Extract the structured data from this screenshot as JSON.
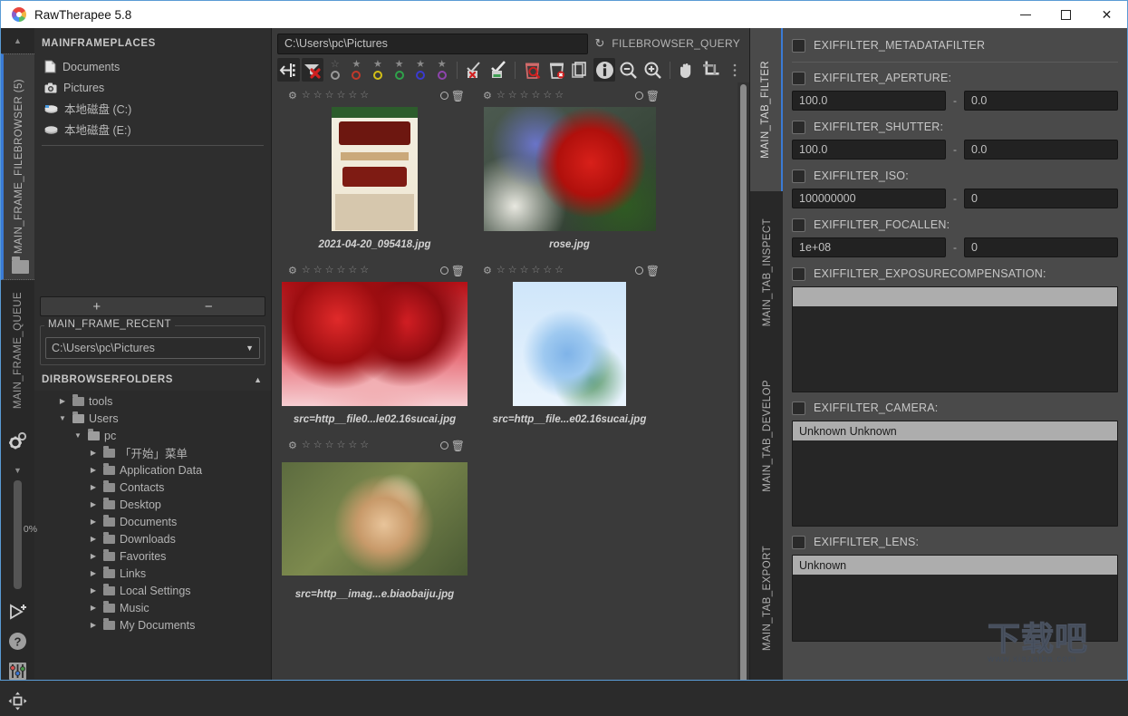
{
  "window": {
    "title": "RawTherapee 5.8",
    "logo_icon": "rawtherapee-logo-icon",
    "controls": [
      {
        "name": "minimize-button",
        "glyph": "minimize-icon"
      },
      {
        "name": "maximize-button",
        "glyph": "maximize-icon"
      },
      {
        "name": "close-button",
        "glyph": "close-icon"
      }
    ]
  },
  "leftbar": {
    "arrow_up": "▲",
    "arrow_down": "▼",
    "tab_filebrowser": "MAIN_FRAME_FILEBROWSER (5)",
    "tab_queue": "MAIN_FRAME_QUEUE",
    "gear_icon": "gears-icon",
    "progress_label": "0%",
    "icons": [
      {
        "name": "batch-edit-icon",
        "glyph": "▷⁺"
      },
      {
        "name": "help-icon",
        "glyph": "?"
      },
      {
        "name": "preferences-sliders-icon",
        "glyph": "sliders"
      },
      {
        "name": "fullscreen-icon",
        "glyph": "arrows"
      }
    ]
  },
  "places": {
    "title": "MAINFRAMEPLACES",
    "items": [
      {
        "label": "Documents",
        "icon": "document-icon"
      },
      {
        "label": "Pictures",
        "icon": "camera-icon"
      },
      {
        "label": "本地磁盘 (C:)",
        "icon": "harddrive-icon"
      },
      {
        "label": "本地磁盘 (E:)",
        "icon": "harddrive-icon"
      }
    ],
    "add_label": "+",
    "remove_label": "−"
  },
  "recent": {
    "legend": "MAIN_FRAME_RECENT",
    "selected": "C:\\Users\\pc\\Pictures",
    "caret": "▼"
  },
  "dirbrowser": {
    "title": "DIRBROWSERFOLDERS",
    "collapse_caret": "▲",
    "nodes": [
      {
        "label": "tools",
        "depth": 1,
        "expander": "▶",
        "open": false
      },
      {
        "label": "Users",
        "depth": 1,
        "expander": "▼",
        "open": true
      },
      {
        "label": "pc",
        "depth": 2,
        "expander": "▼",
        "open": true
      },
      {
        "label": "「开始」菜单",
        "depth": 3,
        "expander": "▶",
        "open": false
      },
      {
        "label": "Application Data",
        "depth": 3,
        "expander": "▶",
        "open": false
      },
      {
        "label": "Contacts",
        "depth": 3,
        "expander": "▶",
        "open": false
      },
      {
        "label": "Desktop",
        "depth": 3,
        "expander": "▶",
        "open": false
      },
      {
        "label": "Documents",
        "depth": 3,
        "expander": "▶",
        "open": false
      },
      {
        "label": "Downloads",
        "depth": 3,
        "expander": "▶",
        "open": false
      },
      {
        "label": "Favorites",
        "depth": 3,
        "expander": "▶",
        "open": false
      },
      {
        "label": "Links",
        "depth": 3,
        "expander": "▶",
        "open": false
      },
      {
        "label": "Local Settings",
        "depth": 3,
        "expander": "▶",
        "open": false
      },
      {
        "label": "Music",
        "depth": 3,
        "expander": "▶",
        "open": false
      },
      {
        "label": "My Documents",
        "depth": 3,
        "expander": "▶",
        "open": false
      }
    ]
  },
  "browser": {
    "path": "C:\\Users\\pc\\Pictures",
    "query_icon": "refresh-icon",
    "query_label": "FILEBROWSER_QUERY",
    "toolbar": {
      "back_label": "back-arrow-icon",
      "clear_filters_label": "clear-filters-icon",
      "ranks": [
        "☆",
        "★",
        "★",
        "★",
        "★",
        "★"
      ],
      "colors": [
        "#9a9a9a",
        "#c0392b",
        "#d4c017",
        "#2fa34a",
        "#3a3ad0",
        "#8e44ad"
      ],
      "edited_icon": "edited-check-icon",
      "unedited_icon": "unedited-check-icon",
      "trash_show_icon": "trash-search-icon",
      "trash_clear_icon": "trash-delete-icon",
      "copy_icon": "copy-profile-icon",
      "info_icon": "info-icon",
      "zoom_out_icon": "zoom-out-icon",
      "zoom_in_icon": "zoom-in-icon",
      "hand_icon": "hand-pan-icon",
      "crop_icon": "crop-icon"
    },
    "thumbnails": [
      {
        "caption": "2021-04-20_095418.jpg",
        "art": "art-ad",
        "rank": 0,
        "icon": "thumbnail-item"
      },
      {
        "caption": "rose.jpg",
        "art": "art-rose",
        "rank": 0,
        "icon": "thumbnail-item"
      },
      {
        "caption": "src=http__file0...le02.16sucai.jpg",
        "art": "art-roses",
        "rank": 0,
        "icon": "thumbnail-item"
      },
      {
        "caption": "src=http__file...e02.16sucai.jpg",
        "art": "art-blue",
        "rank": 0,
        "icon": "thumbnail-item"
      },
      {
        "caption": "src=http__imag...e.biaobaiju.jpg",
        "art": "art-hand",
        "rank": 0,
        "icon": "thumbnail-item"
      }
    ],
    "thumb_header": {
      "gear": "⚙",
      "stars": [
        "☆",
        "☆",
        "☆",
        "☆",
        "☆",
        "☆"
      ],
      "circle": "color-label-icon",
      "trash": "🗑"
    }
  },
  "right_tabs": [
    {
      "label": "MAIN_TAB_FILTER",
      "active": true
    },
    {
      "label": "MAIN_TAB_INSPECT",
      "active": false
    },
    {
      "label": "MAIN_TAB_DEVELOP",
      "active": false
    },
    {
      "label": "MAIN_TAB_EXPORT",
      "active": false
    }
  ],
  "filter_panel": {
    "metadata_filter": {
      "label": "EXIFFILTER_METADATAFILTER",
      "checked": false
    },
    "ranges": [
      {
        "label": "EXIFFILTER_APERTURE:",
        "checked": false,
        "max": "100.0",
        "dash": "-",
        "min": "0.0"
      },
      {
        "label": "EXIFFILTER_SHUTTER:",
        "checked": false,
        "max": "100.0",
        "dash": "-",
        "min": "0.0"
      },
      {
        "label": "EXIFFILTER_ISO:",
        "checked": false,
        "max": "100000000",
        "dash": "-",
        "min": "0"
      },
      {
        "label": "EXIFFILTER_FOCALLEN:",
        "checked": false,
        "max": "1e+08",
        "dash": "-",
        "min": "0"
      }
    ],
    "exposure": {
      "label": "EXIFFILTER_EXPOSURECOMPENSATION:",
      "checked": false,
      "items": [
        {
          "text": "",
          "selected": true
        }
      ]
    },
    "camera": {
      "label": "EXIFFILTER_CAMERA:",
      "checked": false,
      "items": [
        {
          "text": "Unknown Unknown",
          "selected": true
        }
      ]
    },
    "lens": {
      "label": "EXIFFILTER_LENS:",
      "checked": false,
      "items": [
        {
          "text": "Unknown",
          "selected": true
        }
      ]
    }
  },
  "watermark": {
    "text": "下载吧",
    "url": "www.xiazaiba.com"
  }
}
